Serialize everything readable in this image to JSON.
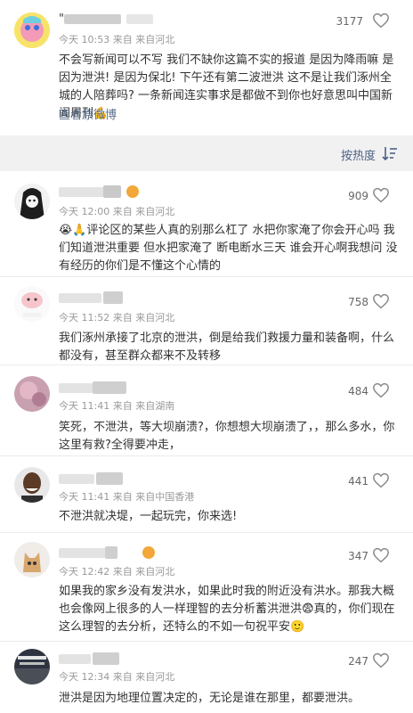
{
  "post": {
    "author_blur_text": "\"",
    "time": "今天 10:53 来自 来自河北",
    "likes": "3177",
    "body": "不会写新闻可以不写 我们不缺你这篇不实的报道 是因为降雨嘛 是因为泄洪! 是因为保北! 下午还有第二波泄洪 这不是让我们涿州全城的人陪葬吗? 一条新闻连实事求是都做不到你也好意思叫中国新闻周刊💪",
    "view_original": "查看原微博"
  },
  "sort": {
    "label": "按热度",
    "icon": "sort-icon"
  },
  "comments": [
    {
      "time": "今天 12:00 来自 来自河北",
      "likes": "909",
      "text": "😭🙏评论区的某些人真的别那么杠了 水把你家淹了你会开心吗 我们知道泄洪重要 但水把家淹了 断电断水三天 谁会开心啊我想问 没有经历的你们是不懂这个心情的"
    },
    {
      "time": "今天 11:52 来自 来自河北",
      "likes": "758",
      "text": "我们涿州承接了北京的泄洪，倒是给我们救援力量和装备啊，什么都没有，甚至群众都来不及转移"
    },
    {
      "time": "今天 11:41 来自 来自湖南",
      "likes": "484",
      "text": "笑死，不泄洪，等大坝崩溃?，你想想大坝崩溃了，，那么多水，你这里有救?全得要冲走，"
    },
    {
      "time": "今天 11:41 来自 来自中国香港",
      "likes": "441",
      "text": "不泄洪就决堤，一起玩完，你来选!"
    },
    {
      "time": "今天 12:42 来自 来自河北",
      "likes": "347",
      "text": "如果我的家乡没有发洪水，如果此时我的附近没有洪水。那我大概也会像网上很多的人一样理智的去分析蓄洪泄洪😨真的，你们现在这么理智的去分析，还特么的不如一句祝平安🙂"
    },
    {
      "time": "今天 12:34 来自 来自河北",
      "likes": "247",
      "text": "泄洪是因为地理位置决定的，无论是谁在那里，都要泄洪。"
    }
  ],
  "colors": {
    "link": "#5a6f8c",
    "meta": "#999999",
    "band": "#f1f1f1",
    "heart": "#888888"
  }
}
